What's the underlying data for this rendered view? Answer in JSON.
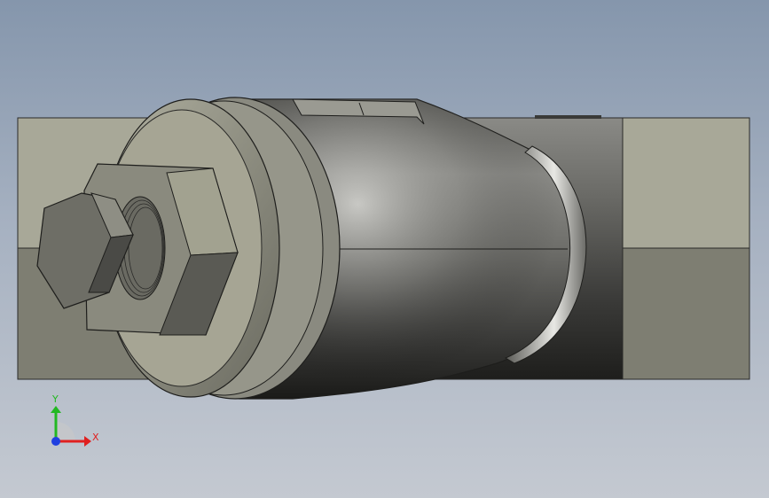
{
  "viewport": {
    "background_top": "#8596ac",
    "background_bottom": "#c4c9d1"
  },
  "triad": {
    "x_label": "X",
    "y_label": "Y",
    "x_color": "#e02020",
    "y_color": "#22b822",
    "z_color": "#2040e0"
  },
  "model": {
    "body_color": "#7a7a72",
    "flange_color": "#a9a898",
    "bolt_color": "#6e6e66"
  }
}
